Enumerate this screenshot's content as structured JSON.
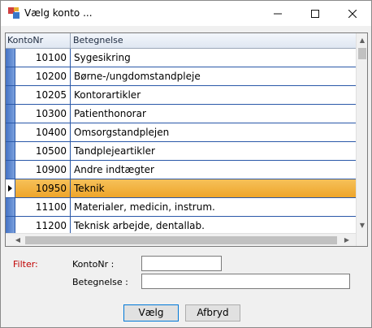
{
  "window": {
    "title": "Vælg konto ...",
    "icons": {
      "app": "app-icon",
      "minimize": "minimize-icon",
      "maximize": "maximize-icon",
      "close": "close-icon"
    }
  },
  "grid": {
    "columns": [
      "KontoNr",
      "Betegnelse"
    ],
    "rows": [
      {
        "nr": "10100",
        "text": "Sygesikring"
      },
      {
        "nr": "10200",
        "text": "Børne-/ungdomstandpleje"
      },
      {
        "nr": "10205",
        "text": "Kontorartikler"
      },
      {
        "nr": "10300",
        "text": "Patienthonorar"
      },
      {
        "nr": "10400",
        "text": "Omsorgstandplejen"
      },
      {
        "nr": "10500",
        "text": "Tandplejeartikler"
      },
      {
        "nr": "10900",
        "text": "Andre indtægter"
      },
      {
        "nr": "10950",
        "text": "Teknik"
      },
      {
        "nr": "11100",
        "text": "Materialer, medicin, instrum."
      },
      {
        "nr": "11200",
        "text": "Teknisk arbejde, dentallab."
      }
    ],
    "selected_index": 7,
    "colors": {
      "selected": "#f2b038",
      "row_border": "#2a58a8"
    }
  },
  "filter": {
    "label": "Filter:",
    "kontonr_label": "KontoNr :",
    "kontonr_value": "",
    "betegnelse_label": "Betegnelse :",
    "betegnelse_value": ""
  },
  "buttons": {
    "ok": "Vælg",
    "cancel": "Afbryd"
  }
}
